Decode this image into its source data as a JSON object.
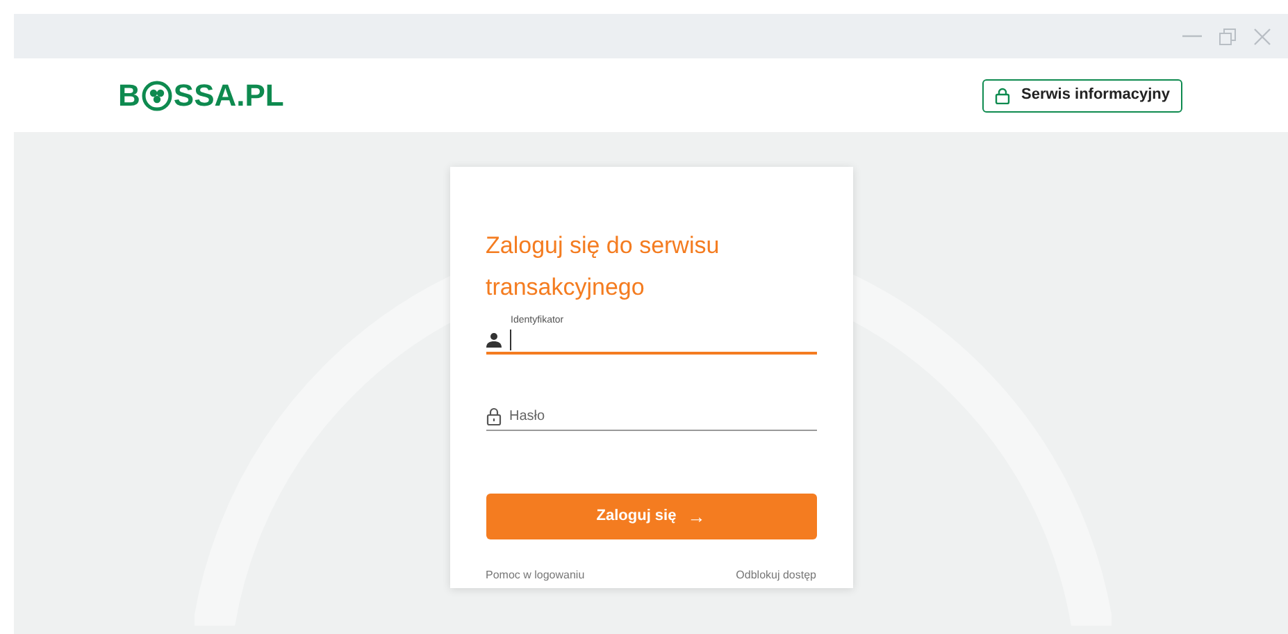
{
  "logo": {
    "before": "B",
    "after": "SSA.PL"
  },
  "header_button": {
    "label": "Serwis informacyjny"
  },
  "login": {
    "title": "Zaloguj się do serwisu transakcyjnego",
    "fields": [
      {
        "kind": "user",
        "label": "Identyfikator",
        "focused": true
      },
      {
        "kind": "password",
        "placeholder": "Hasło",
        "focused": false
      }
    ],
    "submit": {
      "label": "Zaloguj się",
      "arrow": "→"
    },
    "links": [
      "Pomoc w logowaniu",
      "Odblokuj dostęp"
    ]
  }
}
